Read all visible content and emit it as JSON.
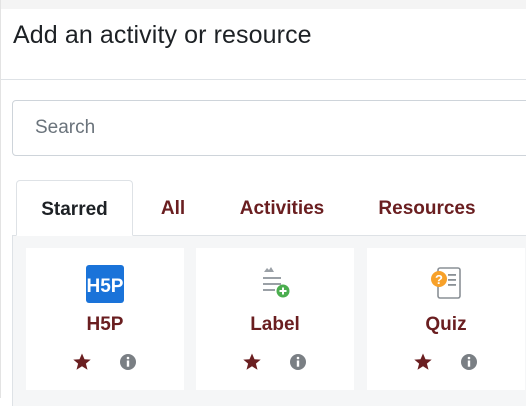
{
  "dialog": {
    "title": "Add an activity or resource"
  },
  "search": {
    "placeholder": "Search",
    "value": ""
  },
  "tabs": [
    {
      "label": "Starred",
      "active": true
    },
    {
      "label": "All",
      "active": false
    },
    {
      "label": "Activities",
      "active": false
    },
    {
      "label": "Resources",
      "active": false
    }
  ],
  "items": [
    {
      "name": "H5P",
      "icon": "h5p-icon",
      "starred": true
    },
    {
      "name": "Label",
      "icon": "label-icon",
      "starred": true
    },
    {
      "name": "Quiz",
      "icon": "quiz-icon",
      "starred": true
    }
  ],
  "colors": {
    "accent": "#6a1e20",
    "h5p_blue": "#1a73d9",
    "quiz_orange": "#f7a12a",
    "label_green": "#4bae4f"
  },
  "icons": {
    "star": "star-icon",
    "info": "info-icon"
  }
}
